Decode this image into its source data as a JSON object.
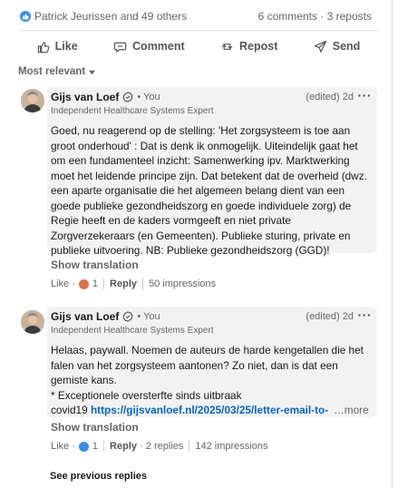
{
  "social": {
    "reactors_text": "Patrick Jeurissen and 49 others",
    "counts_text": "6 comments · 3 reposts"
  },
  "actions": {
    "like": "Like",
    "comment": "Comment",
    "repost": "Repost",
    "send": "Send"
  },
  "sort": {
    "label": "Most relevant"
  },
  "comments": [
    {
      "name": "Gijs van Loef",
      "you": "• You",
      "headline": "Independent Healthcare Systems Expert",
      "edited": "(edited) 2d",
      "text": "Goed, nu reagerend op de stelling: 'Het zorgsysteem is toe aan groot onderhoud' : Dat is denk ik onmogelijk. Uiteindelijk gaat het om een fundamenteel inzicht: Samenwerking ipv. Marktwerking moet het leidende principe zijn. Dat betekent dat de overheid (dwz. een aparte organisatie die het algemeen belang dient van een goede publieke gezondheidszorg en goede individuele zorg) de Regie heeft en de kaders vormgeeft en niet private Zorgverzekeraars (en Gemeenten). Publieke sturing, private en publieke uitvoering. NB: Publieke gezondheidszorg (GGD)!",
      "show_translation": "Show translation",
      "like": "Like",
      "reaction_count": "1",
      "reply": "Reply",
      "impressions": "50 impressions"
    },
    {
      "name": "Gijs van Loef",
      "you": "• You",
      "headline": "Independent Healthcare Systems Expert",
      "edited": "(edited) 2d",
      "text_line1": "Helaas, paywall. Noemen de auteurs de harde kengetallen die het falen van het zorgsysteem aantonen? Zo niet, dan is dat een gemiste kans.",
      "text_line2": "* Exceptionele oversterfte sinds uitbraak",
      "text_prefix": "covid19 ",
      "link": "https://gijsvanloef.nl/2025/03/25/letter-email-to-hur",
      "see_more": "…more",
      "show_translation": "Show translation",
      "like": "Like",
      "reaction_count": "1",
      "reply": "Reply",
      "replies": "2 replies",
      "impressions": "142 impressions"
    }
  ],
  "see_previous_replies": "See previous replies",
  "colors": {
    "link": "#0a66c2",
    "bubble": "#f2f2f2",
    "like_blue": "#378fe9"
  }
}
